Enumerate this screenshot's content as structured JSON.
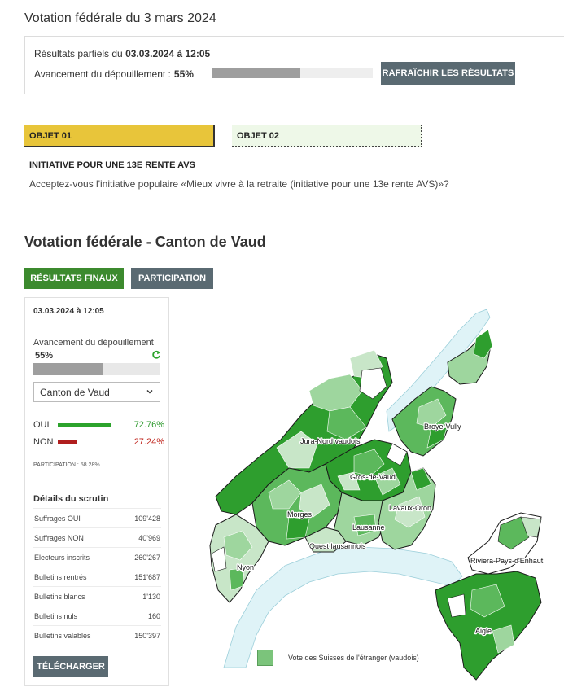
{
  "page_title": "Votation fédérale du 3 mars 2024",
  "partial": {
    "prefix": "Résultats partiels du",
    "date": "03.03.2024 à 12:05",
    "progress_label": "Avancement du dépouillement :",
    "progress_value": "55%",
    "progress_fraction": 0.55,
    "refresh_label": "RAFRAÎCHIR LES RÉSULTATS"
  },
  "tabs": [
    {
      "label": "OBJET 01",
      "active": true
    },
    {
      "label": "OBJET 02",
      "active": false
    }
  ],
  "objet": {
    "title": "INITIATIVE POUR UNE 13E RENTE AVS",
    "question": "Acceptez-vous l'initiative populaire «Mieux vivre à la retraite (initiative pour une 13e rente AVS)»?"
  },
  "section_title": "Votation fédérale - Canton de Vaud",
  "buttons": {
    "final": "RÉSULTATS FINAUX",
    "participation": "PARTICIPATION",
    "download": "TÉLÉCHARGER"
  },
  "sidebar": {
    "date": "03.03.2024 à 12:05",
    "progress_label": "Avancement du dépouillement",
    "progress_value": "55%",
    "progress_fraction": 0.55,
    "select_value": "Canton de Vaud",
    "oui_label": "OUI",
    "oui_pct": "72.76%",
    "non_label": "NON",
    "non_pct": "27.24%",
    "participation": "PARTICIPATION : 58.28%",
    "details_title": "Détails du scrutin",
    "details": [
      {
        "label": "Suffrages OUI",
        "value": "109'428"
      },
      {
        "label": "Suffrages NON",
        "value": "40'969"
      },
      {
        "label": "Electeurs inscrits",
        "value": "260'267"
      },
      {
        "label": "Bulletins rentrés",
        "value": "151'687"
      },
      {
        "label": "Bulletins blancs",
        "value": "1'130"
      },
      {
        "label": "Bulletins nuls",
        "value": "160"
      },
      {
        "label": "Bulletins valables",
        "value": "150'397"
      }
    ]
  },
  "map": {
    "districts": [
      "Jura-Nord vaudois",
      "Broye-Vully",
      "Gros-de-Vaud",
      "Morges",
      "Lavaux-Oron",
      "Lausanne",
      "Ouest lausannois",
      "Nyon",
      "Riviera-Pays-d'Enhaut",
      "Aigle"
    ],
    "legend": "Vote des Suisses de l'étranger (vaudois)",
    "colors": {
      "dark_green": "#2e9e2e",
      "mid_green": "#5cb85c",
      "light_green": "#9ed69e",
      "pale_green": "#c8e6c8",
      "lake": "#dff3f7",
      "not_counted": "#ffffff"
    }
  }
}
